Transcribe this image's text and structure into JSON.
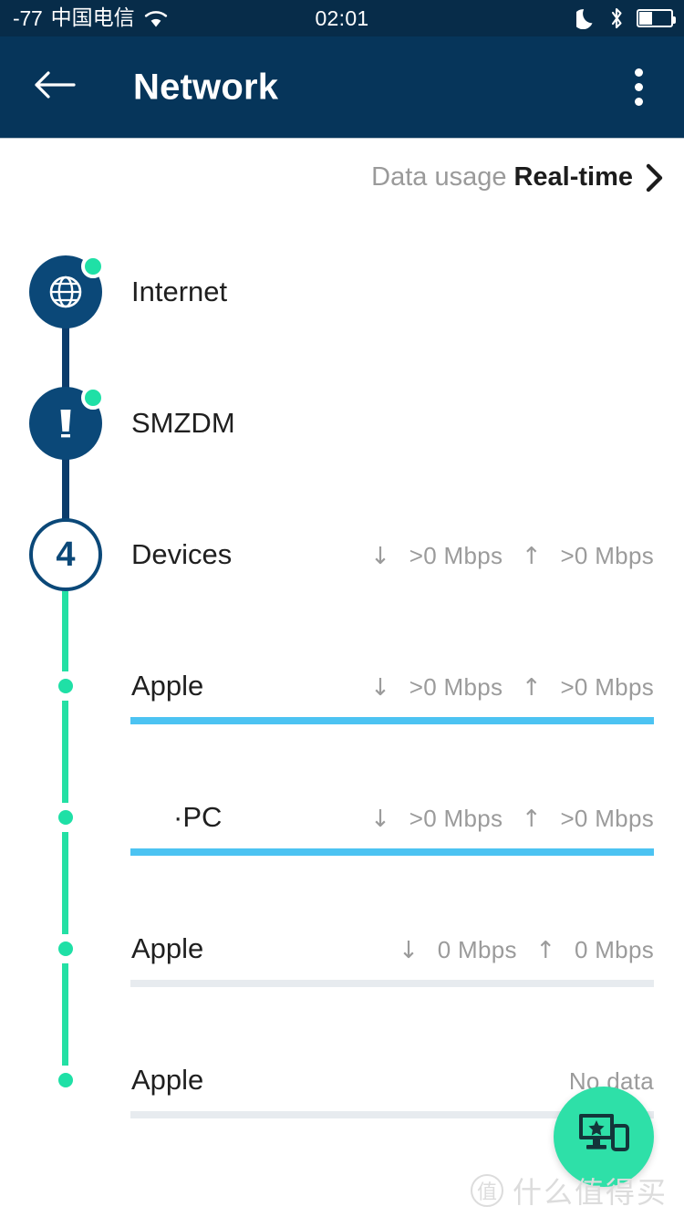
{
  "status_bar": {
    "rssi": "-77",
    "carrier": "中国电信",
    "wifi_icon": "wifi-icon",
    "time": "02:01",
    "moon_icon": "moon-icon",
    "bluetooth_icon": "bluetooth-icon",
    "battery_icon": "battery-icon",
    "battery_percent": 42
  },
  "app_bar": {
    "back_icon": "back-arrow-icon",
    "title": "Network",
    "overflow_icon": "overflow-menu-icon"
  },
  "usage_header": {
    "label": "Data usage",
    "value": "Real-time",
    "chevron_icon": "chevron-right-icon"
  },
  "topology": {
    "internet": {
      "label": "Internet",
      "icon": "globe-icon",
      "status": "online"
    },
    "router": {
      "label": "SMZDM",
      "icon": "router-icon",
      "status": "online"
    },
    "devices": {
      "label": "Devices",
      "count": "4",
      "speed_down": ">0 Mbps",
      "speed_up": ">0 Mbps",
      "down_icon": "↓",
      "up_icon": "↑"
    }
  },
  "devices": [
    {
      "name": "Apple",
      "down_icon": "↓",
      "speed_down": ">0 Mbps",
      "up_icon": "↑",
      "speed_up": ">0 Mbps",
      "bar_state": "active",
      "has_data": true
    },
    {
      "name": "·PC",
      "down_icon": "↓",
      "speed_down": ">0 Mbps",
      "up_icon": "↑",
      "speed_up": ">0 Mbps",
      "bar_state": "active",
      "has_data": true
    },
    {
      "name": "Apple",
      "down_icon": "↓",
      "speed_down": "0 Mbps",
      "up_icon": "↑",
      "speed_up": "0 Mbps",
      "bar_state": "inactive",
      "has_data": true
    },
    {
      "name": "Apple",
      "no_data_label": "No data",
      "bar_state": "inactive",
      "has_data": false
    }
  ],
  "fab": {
    "icon": "device-priority-icon"
  },
  "watermark": {
    "logo_char": "值",
    "text": "什么值得买"
  },
  "colors": {
    "status_bar_bg": "#072c49",
    "app_bar_bg": "#06355a",
    "node_navy": "#0b4878",
    "rail_navy": "#0b3c6b",
    "accent_green": "#1fe0a6",
    "fab_green": "#2ee0a8",
    "bar_active": "#4cc3f2",
    "bar_inactive": "#e7ebef",
    "text_primary": "#1f1f1f",
    "text_muted": "#9b9b9b"
  }
}
